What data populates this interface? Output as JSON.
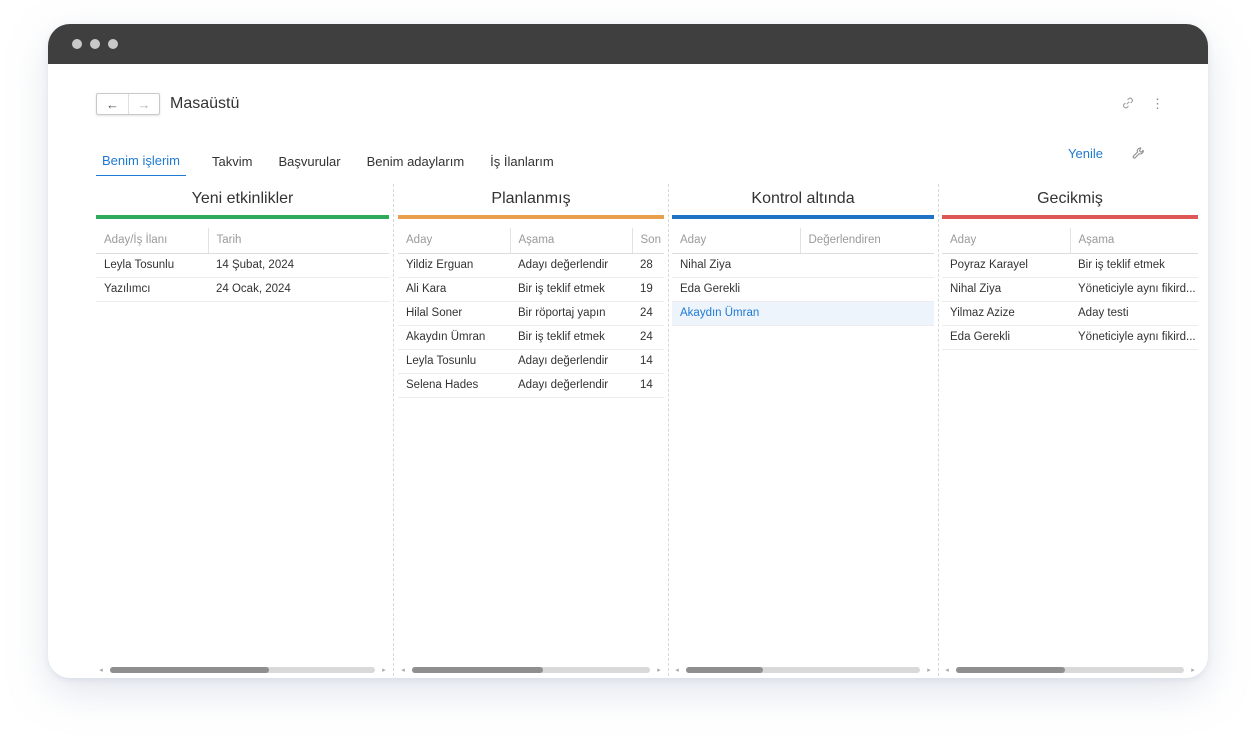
{
  "window": {
    "title_dots": [
      "close",
      "minimize",
      "maximize"
    ]
  },
  "header": {
    "back_label": "←",
    "forward_label": "→",
    "title": "Masaüstü",
    "link_icon": "link-icon",
    "more_icon": "⋮"
  },
  "tabs": [
    {
      "label": "Benim işlerim",
      "active": true
    },
    {
      "label": "Takvim",
      "active": false
    },
    {
      "label": "Başvurular",
      "active": false
    },
    {
      "label": "Benim adaylarım",
      "active": false
    },
    {
      "label": "İş İlanlarım",
      "active": false
    }
  ],
  "toolbar": {
    "refresh_label": "Yenile",
    "settings_icon": "wrench-icon"
  },
  "colors": {
    "accent": "#1e7ad3",
    "new": "#2eaa5c",
    "planned": "#e8a04c",
    "review": "#2073c4",
    "overdue": "#de5757"
  },
  "columns": [
    {
      "title": "Yeni etkinlikler",
      "headers": [
        "Aday/İş İlanı",
        "Tarih"
      ],
      "rows": [
        [
          "Leyla Tosunlu",
          "14 Şubat, 2024"
        ],
        [
          "Yazılımcı",
          "24 Ocak, 2024"
        ]
      ],
      "scroll_fraction": 0.6
    },
    {
      "title": "Planlanmış",
      "headers": [
        "Aday",
        "Aşama",
        "Son"
      ],
      "rows": [
        [
          "Yildiz Erguan",
          "Adayı değerlendir",
          "28"
        ],
        [
          "Ali Kara",
          "Bir iş teklif etmek",
          "19"
        ],
        [
          "Hilal Soner",
          "Bir röportaj yapın",
          "24"
        ],
        [
          "Akaydın Ümran",
          "Bir iş teklif etmek",
          "24"
        ],
        [
          "Leyla Tosunlu",
          "Adayı değerlendir",
          "14"
        ],
        [
          "Selena Hades",
          "Adayı değerlendir",
          "14"
        ]
      ],
      "scroll_fraction": 0.55
    },
    {
      "title": "Kontrol altında",
      "headers": [
        "Aday",
        "Değerlendiren"
      ],
      "rows": [
        [
          "Nihal Ziya",
          ""
        ],
        [
          "Eda Gerekli",
          ""
        ],
        [
          "Akaydın Ümran",
          ""
        ]
      ],
      "selected_row": 2,
      "scroll_fraction": 0.33
    },
    {
      "title": "Gecikmiş",
      "headers": [
        "Aday",
        "Aşama"
      ],
      "rows": [
        [
          "Poyraz Karayel",
          "Bir iş teklif etmek"
        ],
        [
          "Nihal Ziya",
          "Yöneticiyle aynı fikird..."
        ],
        [
          "Yilmaz Azize",
          "Aday testi"
        ],
        [
          "Eda Gerekli",
          "Yöneticiyle aynı fikird..."
        ]
      ],
      "scroll_fraction": 0.48
    }
  ]
}
